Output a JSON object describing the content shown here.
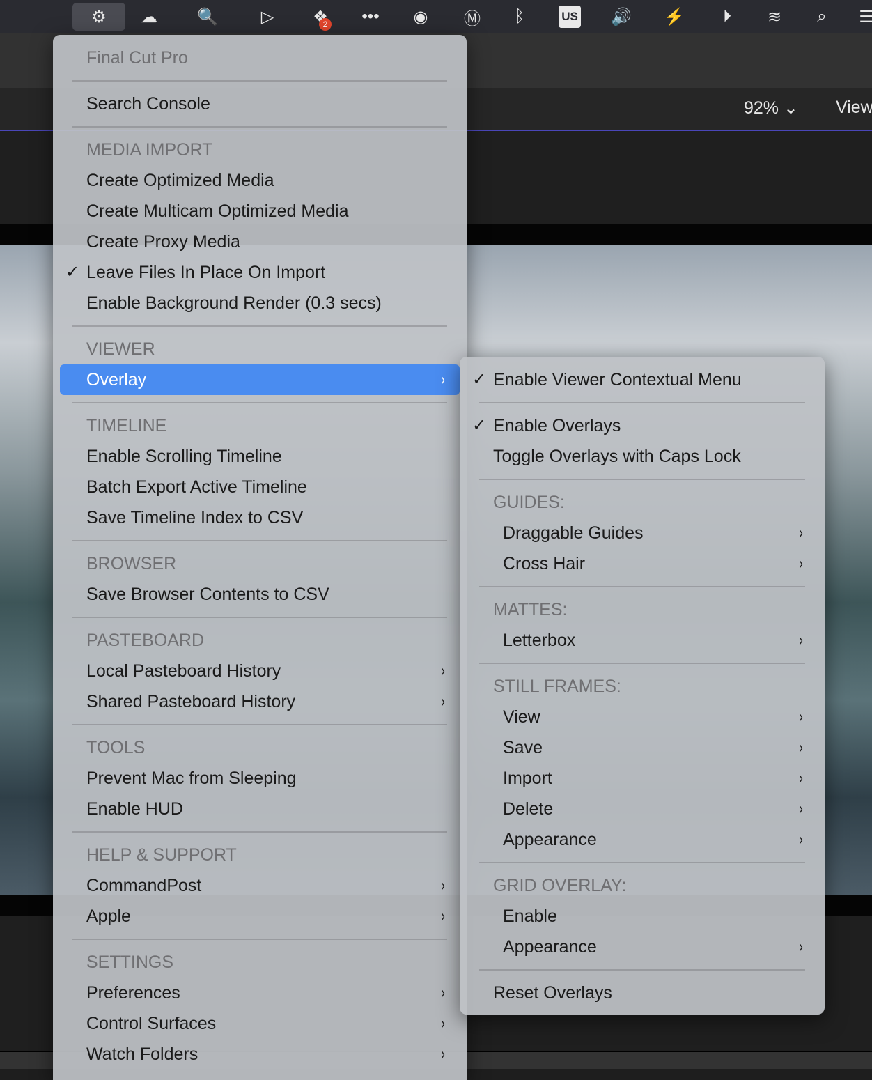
{
  "menubar": {
    "icons": [
      "commandpost-icon",
      "creative-cloud-icon",
      "search-app-icon",
      "screen-record-icon",
      "dropbox-icon",
      "more-dots-icon",
      "audio-waveform-icon",
      "m-app-icon",
      "bluetooth-icon",
      "keyboard-input-icon",
      "volume-icon",
      "battery-charging-icon",
      "play-icon",
      "wifi-icon",
      "spotlight-search-icon",
      "control-center-icon"
    ],
    "dropbox_badge": "2",
    "input_source": "US"
  },
  "viewer": {
    "zoom": "92%",
    "view_label": "View"
  },
  "main_menu": [
    {
      "t": "hdr",
      "label": "Final Cut Pro"
    },
    {
      "t": "sep"
    },
    {
      "t": "item",
      "label": "Search Console"
    },
    {
      "t": "sep"
    },
    {
      "t": "hdr",
      "label": "MEDIA IMPORT"
    },
    {
      "t": "item",
      "label": "Create Optimized Media"
    },
    {
      "t": "item",
      "label": "Create Multicam Optimized Media"
    },
    {
      "t": "item",
      "label": "Create Proxy Media"
    },
    {
      "t": "item",
      "label": "Leave Files In Place On Import",
      "checked": true
    },
    {
      "t": "item",
      "label": "Enable Background Render (0.3 secs)"
    },
    {
      "t": "sep"
    },
    {
      "t": "hdr",
      "label": "VIEWER"
    },
    {
      "t": "item",
      "label": "Overlay",
      "submenu": true,
      "highlighted": true
    },
    {
      "t": "sep"
    },
    {
      "t": "hdr",
      "label": "TIMELINE"
    },
    {
      "t": "item",
      "label": "Enable Scrolling Timeline"
    },
    {
      "t": "item",
      "label": "Batch Export Active Timeline"
    },
    {
      "t": "item",
      "label": "Save Timeline Index to CSV"
    },
    {
      "t": "sep"
    },
    {
      "t": "hdr",
      "label": "BROWSER"
    },
    {
      "t": "item",
      "label": "Save Browser Contents to CSV"
    },
    {
      "t": "sep"
    },
    {
      "t": "hdr",
      "label": "PASTEBOARD"
    },
    {
      "t": "item",
      "label": "Local Pasteboard History",
      "submenu": true
    },
    {
      "t": "item",
      "label": "Shared Pasteboard History",
      "submenu": true
    },
    {
      "t": "sep"
    },
    {
      "t": "hdr",
      "label": "TOOLS"
    },
    {
      "t": "item",
      "label": "Prevent Mac from Sleeping"
    },
    {
      "t": "item",
      "label": "Enable HUD"
    },
    {
      "t": "sep"
    },
    {
      "t": "hdr",
      "label": "HELP & SUPPORT"
    },
    {
      "t": "item",
      "label": "CommandPost",
      "submenu": true
    },
    {
      "t": "item",
      "label": "Apple",
      "submenu": true
    },
    {
      "t": "sep"
    },
    {
      "t": "hdr",
      "label": "SETTINGS"
    },
    {
      "t": "item",
      "label": "Preferences",
      "submenu": true
    },
    {
      "t": "item",
      "label": "Control Surfaces",
      "submenu": true
    },
    {
      "t": "item",
      "label": "Watch Folders",
      "submenu": true
    }
  ],
  "overlay_submenu": [
    {
      "t": "item",
      "label": "Enable Viewer Contextual Menu",
      "checked": true
    },
    {
      "t": "sep"
    },
    {
      "t": "item",
      "label": "Enable Overlays",
      "checked": true
    },
    {
      "t": "item",
      "label": "Toggle Overlays with Caps Lock"
    },
    {
      "t": "sep"
    },
    {
      "t": "hdr",
      "label": "GUIDES:"
    },
    {
      "t": "item",
      "label": "Draggable Guides",
      "submenu": true,
      "indent": true
    },
    {
      "t": "item",
      "label": "Cross Hair",
      "submenu": true,
      "indent": true
    },
    {
      "t": "sep"
    },
    {
      "t": "hdr",
      "label": "MATTES:"
    },
    {
      "t": "item",
      "label": "Letterbox",
      "submenu": true,
      "indent": true
    },
    {
      "t": "sep"
    },
    {
      "t": "hdr",
      "label": "STILL FRAMES:"
    },
    {
      "t": "item",
      "label": "View",
      "submenu": true,
      "indent": true
    },
    {
      "t": "item",
      "label": "Save",
      "submenu": true,
      "indent": true
    },
    {
      "t": "item",
      "label": "Import",
      "submenu": true,
      "indent": true
    },
    {
      "t": "item",
      "label": "Delete",
      "submenu": true,
      "indent": true
    },
    {
      "t": "item",
      "label": "Appearance",
      "submenu": true,
      "indent": true
    },
    {
      "t": "sep"
    },
    {
      "t": "hdr",
      "label": "GRID OVERLAY:"
    },
    {
      "t": "item",
      "label": "Enable",
      "indent": true
    },
    {
      "t": "item",
      "label": "Appearance",
      "submenu": true,
      "indent": true
    },
    {
      "t": "sep"
    },
    {
      "t": "item",
      "label": "Reset Overlays"
    }
  ],
  "glyphs": {
    "check": "✓",
    "chevron": "›"
  }
}
